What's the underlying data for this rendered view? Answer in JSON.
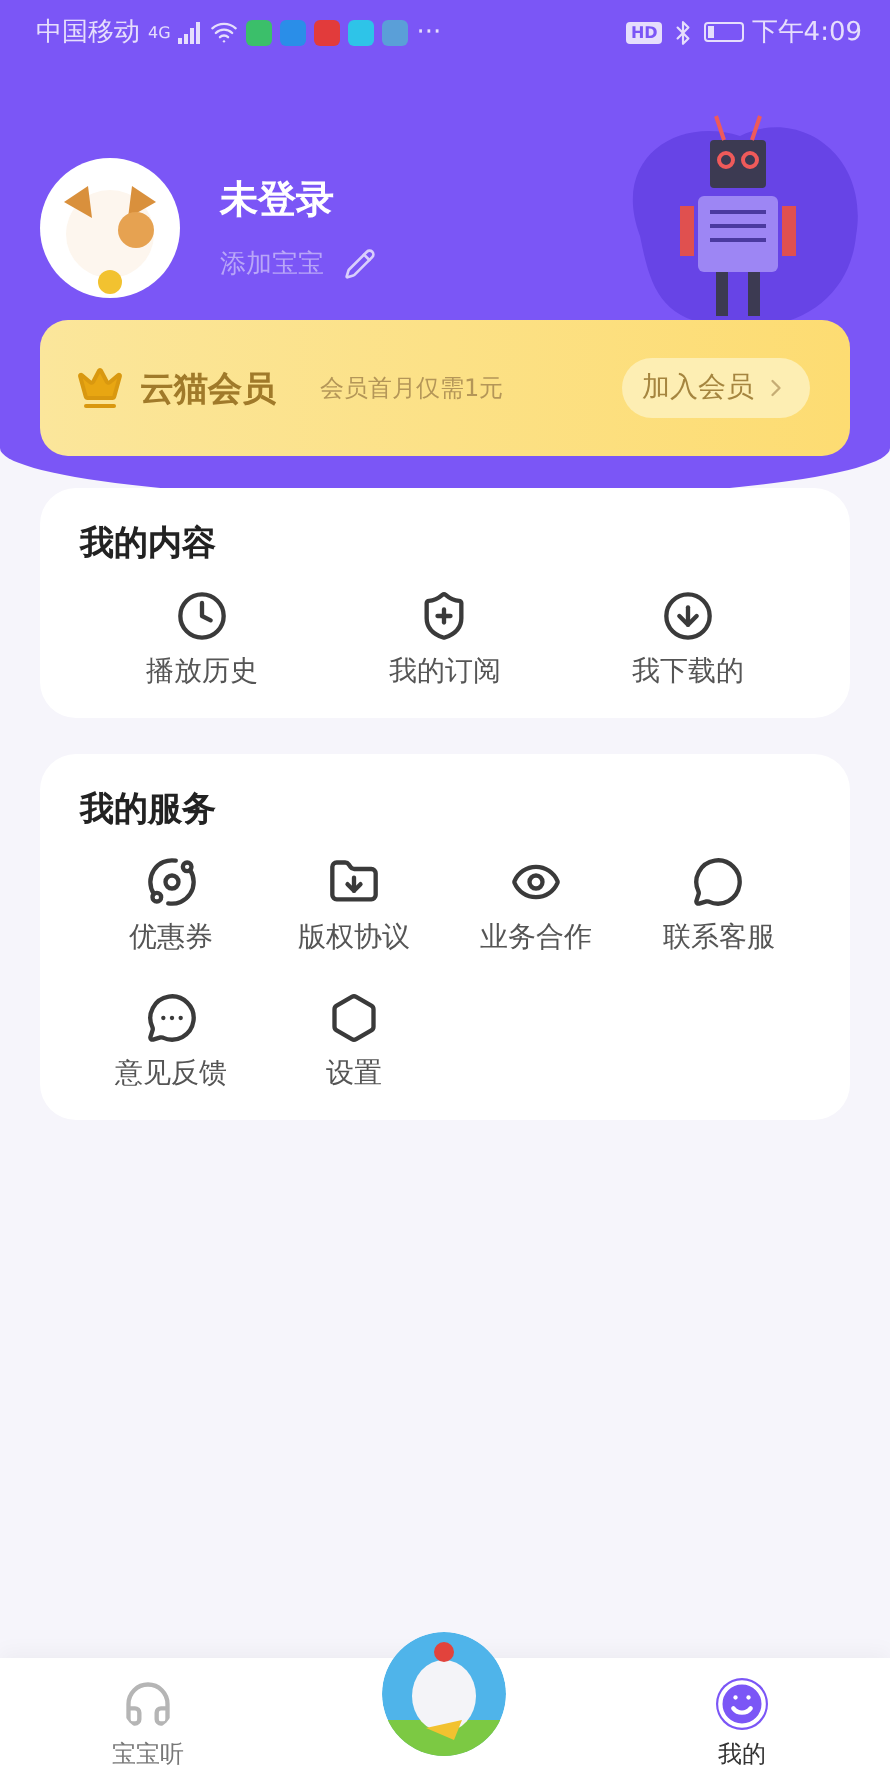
{
  "status_bar": {
    "carrier": "中国移动",
    "network": "4G",
    "more": "···",
    "hd": "HD",
    "time": "下午4:09"
  },
  "profile": {
    "name": "未登录",
    "subtitle": "添加宝宝"
  },
  "membership": {
    "title": "云猫会员",
    "promo": "会员首月仅需1元",
    "button": "加入会员"
  },
  "sections": [
    {
      "title": "我的内容",
      "items": [
        {
          "label": "播放历史"
        },
        {
          "label": "我的订阅"
        },
        {
          "label": "我下载的"
        }
      ]
    },
    {
      "title": "我的服务",
      "items": [
        {
          "label": "优惠券"
        },
        {
          "label": "版权协议"
        },
        {
          "label": "业务合作"
        },
        {
          "label": "联系客服"
        },
        {
          "label": "意见反馈"
        },
        {
          "label": "设置"
        }
      ]
    }
  ],
  "tabs": [
    {
      "label": "宝宝听",
      "kind": "headset",
      "selected": false
    },
    {
      "kind": "center",
      "selected": false
    },
    {
      "label": "我的",
      "kind": "smile",
      "selected": true
    }
  ]
}
